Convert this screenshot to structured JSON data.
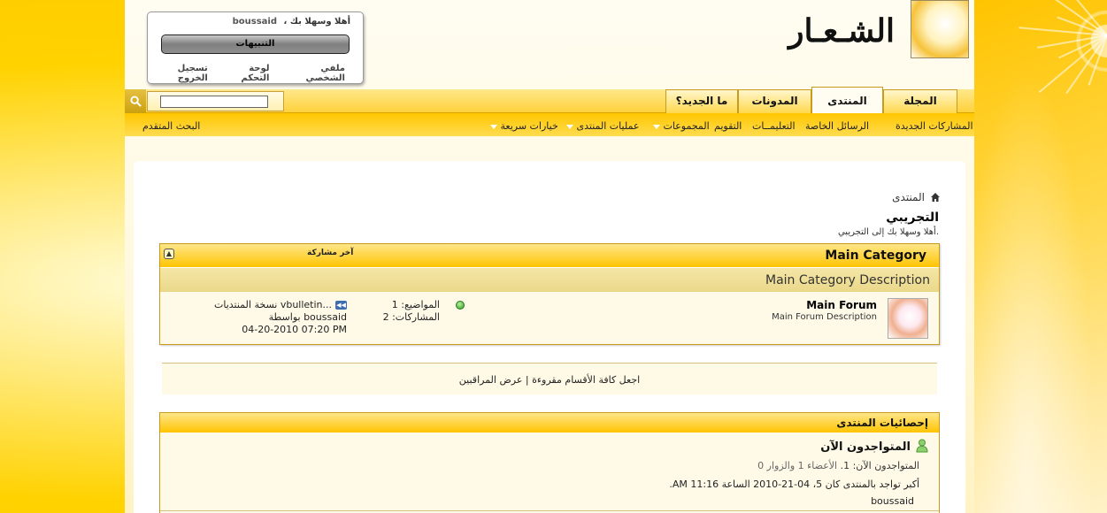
{
  "header": {
    "site_title": "الشـعـار",
    "welcome_text": "أهلا وسهلا بك ،",
    "username": "boussaid",
    "notifications_label": "التنبيهات",
    "links": [
      "ملفي الشخصي",
      "لوحة التحكم",
      "تسجيل الخروج"
    ]
  },
  "tabs": [
    {
      "label": "المجلة",
      "active": false
    },
    {
      "label": "المنتدى",
      "active": true
    },
    {
      "label": "المدونات",
      "active": false
    },
    {
      "label": "ما الجديد؟",
      "active": false
    }
  ],
  "search": {
    "value": "",
    "placeholder": ""
  },
  "navbar": {
    "items": [
      "المشاركات الجديدة",
      "الرسائل الخاصة",
      "التعليمــات",
      "التقويم",
      "المجموعات",
      "عمليات المنتدى",
      "خيارات سريعة"
    ],
    "advanced_search": "البحث المتقدم"
  },
  "breadcrumb": {
    "label": "المنتدى"
  },
  "page": {
    "title": "التجريبي",
    "description": "أهلا وسهلا بك إلى التجريبي."
  },
  "category": {
    "title": "Main Category",
    "last_post_header": "آخر مشاركة",
    "description": "Main Category Description",
    "forum": {
      "name": "Main Forum",
      "description": "Main Forum Description",
      "threads_label": "المواضيع:",
      "threads_value": "1",
      "posts_label": "المشاركات:",
      "posts_value": "2",
      "last_post_title": "نسخة المنتديات vbulletin...",
      "last_post_by": "بواسطة boussaid",
      "last_post_date": "04-20-2010 07:20 PM"
    }
  },
  "actions": {
    "mark_read": "اجعل كافة الأقسام مقروءة",
    "separator": "|",
    "view_moderators": "عرض المراقبين"
  },
  "stats": {
    "title": "إحصائيات المنتدى",
    "online_title": "المتواجدون الآن",
    "online_prefix": "المتواجدون الآن:",
    "online_total": "1.",
    "online_detail": "الأعضاء 1 والزوار 0",
    "record_line": "أكبر تواجد بالمنتدى كان 5، 04-21-2010 الساعة 11:16 AM.",
    "online_user": "boussaid"
  },
  "colors": {
    "accent": "#ffc400",
    "background": "#ffd200",
    "panel": "#fffae8"
  }
}
